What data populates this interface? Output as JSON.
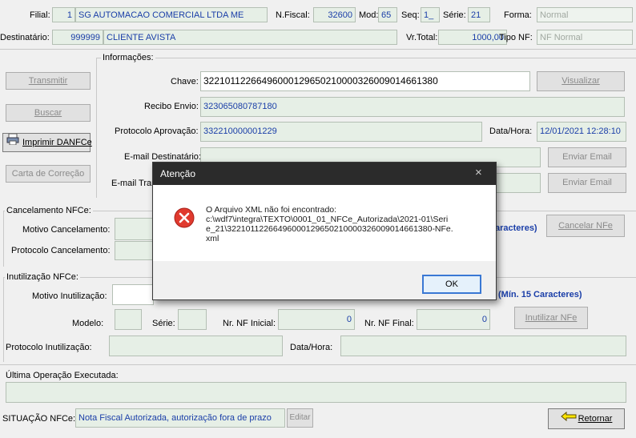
{
  "header": {
    "filial_label": "Filial:",
    "filial_code": "1",
    "filial_name": "SG AUTOMACAO COMERCIAL LTDA ME",
    "nfiscal_label": "N.Fiscal:",
    "nfiscal_value": "32600",
    "mod_label": "Mod:",
    "mod_value": "65",
    "seq_label": "Seq:",
    "seq_value": "1_",
    "serie_label": "Série:",
    "serie_value": "21",
    "forma_label": "Forma:",
    "forma_value": "Normal",
    "destinatario_label": "Destinatário:",
    "destinatario_code": "999999",
    "destinatario_name": "CLIENTE AVISTA",
    "vrtotal_label": "Vr.Total:",
    "vrtotal_value": "1000,00",
    "tiponf_label": "Tipo NF:",
    "tiponf_value": "NF Normal"
  },
  "left_buttons": {
    "transmitir": "Transmitir",
    "buscar": "Buscar",
    "imprimir": "Imprimir DANFCe",
    "carta": "Carta de Correção"
  },
  "info": {
    "group_label": "Informações:",
    "chave_label": "Chave:",
    "chave_value": "32210112266496000129650210000326009014661380",
    "visualizar": "Visualizar",
    "recibo_label": "Recibo Envio:",
    "recibo_value": "323065080787180",
    "protocolo_label": "Protocolo Aprovação:",
    "protocolo_value": "332210000001229",
    "datahora_label": "Data/Hora:",
    "datahora_value": "12/01/2021 12:28:10",
    "email_dest_label": "E-mail Destinatário:",
    "email_trans_label": "E-mail Tran",
    "enviar_email_1": "Enviar Email",
    "enviar_email_2": "Enviar Email"
  },
  "cancel": {
    "group_label": "Cancelamento NFCe:",
    "motivo_label": "Motivo Cancelamento:",
    "protocolo_label": "Protocolo Cancelamento:",
    "hint": "aracteres)",
    "button": "Cancelar NFe"
  },
  "inut": {
    "group_label": "Inutilização NFCe:",
    "motivo_label": "Motivo Inutilização:",
    "hint": "(Mín. 15 Caracteres)",
    "modelo_label": "Modelo:",
    "serie_label": "Série:",
    "nf_inicial_label": "Nr. NF Inicial:",
    "nf_inicial_value": "0",
    "nf_final_label": "Nr. NF Final:",
    "nf_final_value": "0",
    "button": "Inutilizar NFe",
    "protocolo_label": "Protocolo Inutilização:",
    "datahora_label": "Data/Hora:"
  },
  "last_op": {
    "label": "Última Operação Executada:"
  },
  "footer": {
    "situacao_label": "SITUAÇÃO NFCe:",
    "situacao_value": "Nota Fiscal Autorizada, autorização fora de prazo",
    "editar": "Editar",
    "retornar": "Retornar"
  },
  "dialog": {
    "title": "Atenção",
    "close": "×",
    "message_line1": "O Arquivo XML não foi encontrado:",
    "message_line2": "c:\\wdf7\\integra\\TEXTO\\0001_01_NFCe_Autorizada\\2021-01\\Seri",
    "message_line3": "e_21\\32210112266496000129650210000326009014661380-NFe.",
    "message_line4": "xml",
    "ok": "OK"
  },
  "colors": {
    "field_bg": "#e6efe6",
    "value_text": "#1a3ea8",
    "error_red": "#e03a2e",
    "dialog_title_bg": "#2b2b2b"
  }
}
